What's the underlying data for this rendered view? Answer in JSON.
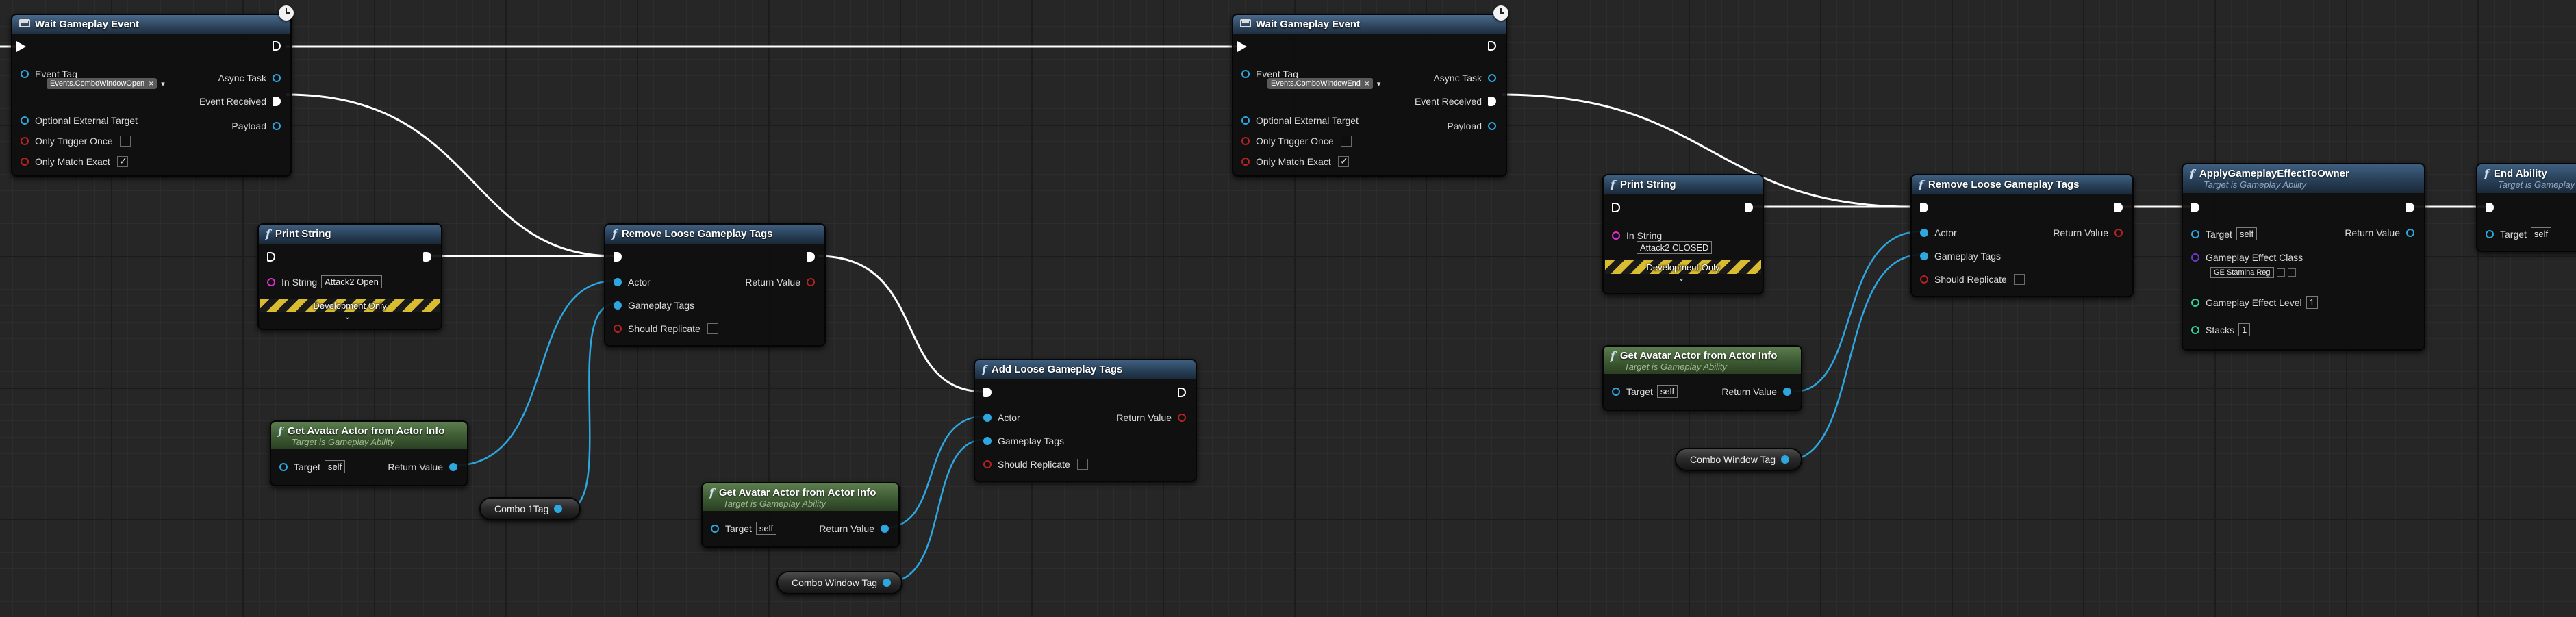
{
  "colors": {
    "exec": "#ffffff",
    "object_pin": "#2ea6df",
    "bool_pin": "#b62222",
    "string_pin": "#e12fd2",
    "int_pin": "#2fd59a",
    "class_pin": "#6a3ad0",
    "node_header_blue": "#2f4760",
    "node_header_green": "#3d5a33"
  },
  "icons": {
    "function": "function-f-icon",
    "latent": "latent-event-icon",
    "clock": "clock-icon",
    "exec_pin": "exec-pin-icon",
    "data_pin": "data-pin-icon",
    "checkbox": "checkbox-icon",
    "expand": "chevron-down-icon"
  },
  "wait1": {
    "title": "Wait Gameplay Event",
    "event_tag_label": "Event Tag",
    "event_tag_value": "Events.ComboWindowOpen",
    "tag_clear": "×",
    "async_task": "Async Task",
    "event_received": "Event Received",
    "payload": "Payload",
    "optional_target": "Optional External Target",
    "only_trigger_once": "Only Trigger Once",
    "only_match_exact": "Only Match Exact",
    "dropdown": "▾"
  },
  "wait2": {
    "title": "Wait Gameplay Event",
    "event_tag_label": "Event Tag",
    "event_tag_value": "Events.ComboWindowEnd",
    "tag_clear": "×",
    "async_task": "Async Task",
    "event_received": "Event Received",
    "payload": "Payload",
    "optional_target": "Optional External Target",
    "only_trigger_once": "Only Trigger Once",
    "only_match_exact": "Only Match Exact",
    "dropdown": "▾"
  },
  "print1": {
    "title": "Print String",
    "in_string_label": "In String",
    "in_string_value": "Attack2 Open",
    "dev_only": "Development Only",
    "chevron": "⌄"
  },
  "print2": {
    "title": "Print String",
    "in_string_label": "In String",
    "in_string_value": "Attack2 CLOSED",
    "dev_only": "Development Only",
    "chevron": "⌄"
  },
  "remove1": {
    "title": "Remove Loose Gameplay Tags",
    "actor": "Actor",
    "gameplay_tags": "Gameplay Tags",
    "should_replicate": "Should Replicate",
    "return_value": "Return Value"
  },
  "remove2": {
    "title": "Remove Loose Gameplay Tags",
    "actor": "Actor",
    "gameplay_tags": "Gameplay Tags",
    "should_replicate": "Should Replicate",
    "return_value": "Return Value"
  },
  "add1": {
    "title": "Add Loose Gameplay Tags",
    "actor": "Actor",
    "gameplay_tags": "Gameplay Tags",
    "should_replicate": "Should Replicate",
    "return_value": "Return Value"
  },
  "avatar1": {
    "title": "Get Avatar Actor from Actor Info",
    "subtitle": "Target is Gameplay Ability",
    "target": "Target",
    "target_value": "self",
    "return_value": "Return Value"
  },
  "avatar2": {
    "title": "Get Avatar Actor from Actor Info",
    "subtitle": "Target is Gameplay Ability",
    "target": "Target",
    "target_value": "self",
    "return_value": "Return Value"
  },
  "avatar3": {
    "title": "Get Avatar Actor from Actor Info",
    "subtitle": "Target is Gameplay Ability",
    "target": "Target",
    "target_value": "self",
    "return_value": "Return Value"
  },
  "var1": {
    "label": "Combo 1Tag"
  },
  "var2": {
    "label": "Combo Window Tag"
  },
  "var3": {
    "label": "Combo Window Tag"
  },
  "apply": {
    "title": "ApplyGameplayEffectToOwner",
    "subtitle": "Target is Gameplay Ability",
    "target": "Target",
    "target_value": "self",
    "return_value": "Return Value",
    "effect_class": "Gameplay Effect Class",
    "effect_class_value": "GE Stamina Reg",
    "effect_level": "Gameplay Effect Level",
    "effect_level_value": "1",
    "stacks": "Stacks",
    "stacks_value": "1"
  },
  "end": {
    "title": "End Ability",
    "subtitle": "Target is Gameplay Ability",
    "target": "Target",
    "target_value": "self"
  }
}
